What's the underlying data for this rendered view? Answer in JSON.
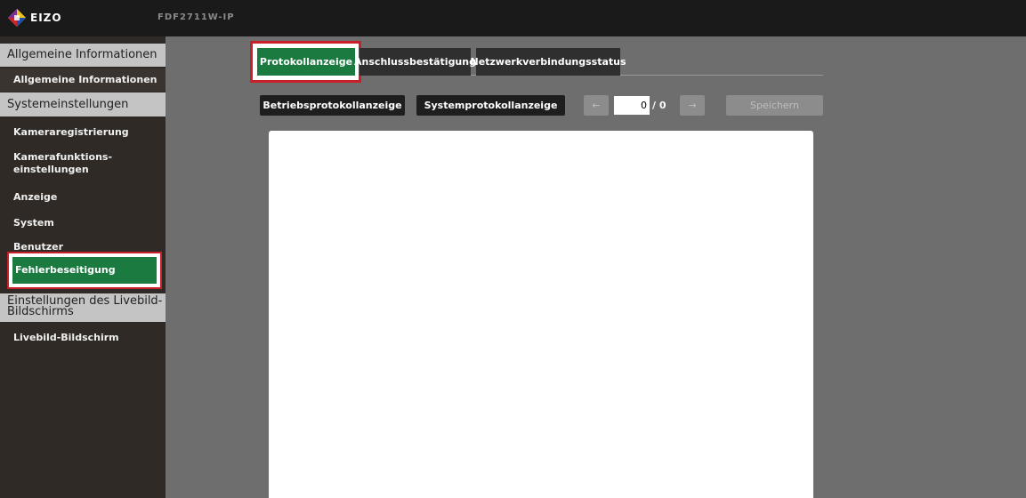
{
  "header": {
    "logo_text": "EIZO",
    "model_name": "FDF2711W-IP"
  },
  "sidebar": {
    "sections": [
      {
        "title": "Allgemeine Informationen",
        "items": [
          "Allgemeine Informationen"
        ]
      },
      {
        "title": "Systemeinstellungen",
        "items": [
          "Kameraregistrierung",
          "Kamerafunktions-\neinstellungen",
          "Anzeige",
          "System",
          "Benutzer",
          "Fehlerbeseitigung"
        ]
      },
      {
        "title": "Einstellungen des Livebild-\nBildschirms",
        "items": [
          "Livebild-Bildschirm"
        ]
      }
    ],
    "active_item": "Fehlerbeseitigung"
  },
  "tabs": [
    {
      "label": "Protokollanzeige",
      "active": true
    },
    {
      "label": "Anschlussbestätigung",
      "active": false
    },
    {
      "label": "Netzwerkverbindungsstatus",
      "active": false
    }
  ],
  "toolbar": {
    "operation_log_label": "Betriebsprotokollanzeige",
    "system_log_label": "Systemprotokollanzeige",
    "prev_label": "←",
    "page_value": "0",
    "page_total": "/ 0",
    "next_label": "→",
    "save_label": "Speichern"
  },
  "colors": {
    "active_green": "#1b7a40",
    "highlight_red": "#c91f28",
    "content_bg": "#6e6e6e",
    "sidebar_bg": "#2f2a26"
  }
}
